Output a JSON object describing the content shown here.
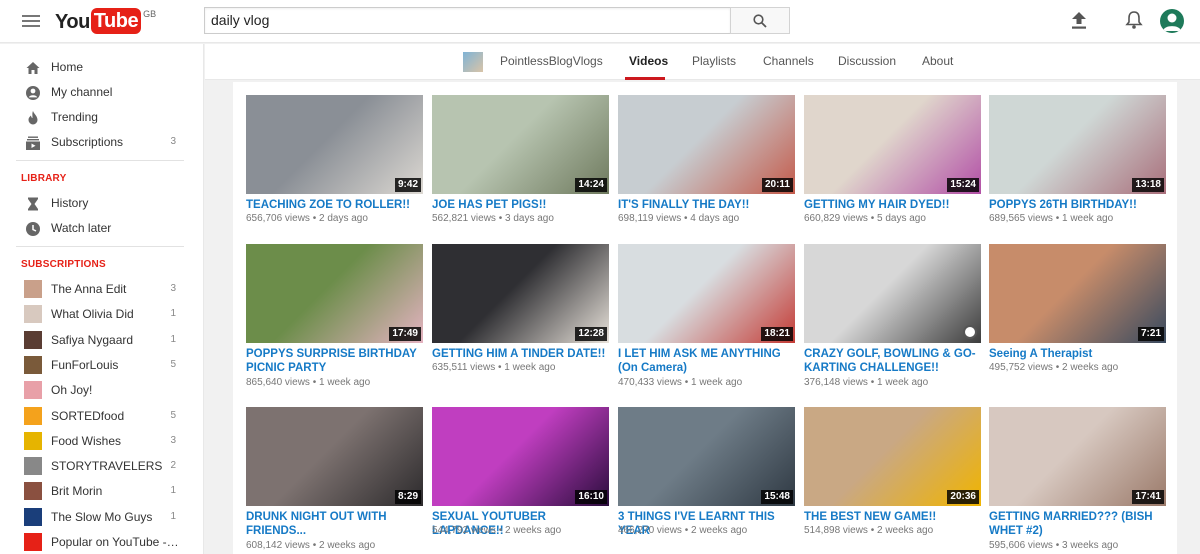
{
  "header": {
    "logo_you": "You",
    "logo_tube": "Tube",
    "logo_region": "GB",
    "search_value": "daily vlog"
  },
  "sidebar": {
    "nav": [
      {
        "label": "Home",
        "icon": "home-icon"
      },
      {
        "label": "My channel",
        "icon": "person-icon"
      },
      {
        "label": "Trending",
        "icon": "flame-icon"
      },
      {
        "label": "Subscriptions",
        "icon": "subscriptions-icon",
        "count": "3"
      }
    ],
    "library_heading": "LIBRARY",
    "library": [
      {
        "label": "History",
        "icon": "hourglass-icon"
      },
      {
        "label": "Watch later",
        "icon": "clock-icon"
      }
    ],
    "subscriptions_heading": "SUBSCRIPTIONS",
    "subscriptions": [
      {
        "label": "The Anna Edit",
        "count": "3",
        "color": "#c9a08a"
      },
      {
        "label": "What Olivia Did",
        "count": "1",
        "color": "#d8c9bf"
      },
      {
        "label": "Safiya Nygaard",
        "count": "1",
        "color": "#5a3d33"
      },
      {
        "label": "FunForLouis",
        "count": "5",
        "color": "#7a5a3a"
      },
      {
        "label": "Oh Joy!",
        "count": "",
        "color": "#e8a0a8"
      },
      {
        "label": "SORTEDfood",
        "count": "5",
        "color": "#f4a21c"
      },
      {
        "label": "Food Wishes",
        "count": "3",
        "color": "#e6b400"
      },
      {
        "label": "STORYTRAVELERS",
        "count": "2",
        "color": "#888888"
      },
      {
        "label": "Brit Morin",
        "count": "1",
        "color": "#8a5040"
      },
      {
        "label": "The Slow Mo Guys",
        "count": "1",
        "color": "#1a3e7a"
      },
      {
        "label": "Popular on YouTube - U...",
        "count": "",
        "color": "#e62117"
      }
    ]
  },
  "channel": {
    "name": "PointlessBlogVlogs",
    "tabs": [
      "Videos",
      "Playlists",
      "Channels",
      "Discussion",
      "About"
    ],
    "active_tab": "Videos"
  },
  "videos": [
    {
      "title": "TEACHING ZOE TO ROLLER!!",
      "views": "656,706 views",
      "age": "2 days ago",
      "duration": "9:42",
      "colors": [
        "#8a8f96",
        "#dcd8d2"
      ]
    },
    {
      "title": "JOE HAS PET PIGS!!",
      "views": "562,821 views",
      "age": "3 days ago",
      "duration": "14:24",
      "colors": [
        "#b7c4b0",
        "#6f7a5e"
      ]
    },
    {
      "title": "IT'S FINALLY THE DAY!!",
      "views": "698,119 views",
      "age": "4 days ago",
      "duration": "20:11",
      "colors": [
        "#c7cdd1",
        "#c45a4a"
      ]
    },
    {
      "title": "GETTING MY HAIR DYED!!",
      "views": "660,829 views",
      "age": "5 days ago",
      "duration": "15:24",
      "colors": [
        "#e0d6cc",
        "#b24fa6"
      ]
    },
    {
      "title": "POPPYS 26TH BIRTHDAY!!",
      "views": "689,565 views",
      "age": "1 week ago",
      "duration": "13:18",
      "colors": [
        "#cfd7d5",
        "#a96f7b"
      ]
    },
    {
      "title": "POPPYS SURPRISE BIRTHDAY PICNIC PARTY",
      "views": "865,640 views",
      "age": "1 week ago",
      "duration": "17:49",
      "colors": [
        "#6c8d4a",
        "#e4b3c1"
      ]
    },
    {
      "title": "GETTING HIM A TINDER DATE!!",
      "views": "635,511 views",
      "age": "1 week ago",
      "duration": "12:28",
      "colors": [
        "#2f2f33",
        "#e8e2da"
      ]
    },
    {
      "title": "I LET HIM ASK ME ANYTHING (On Camera)",
      "views": "470,433 views",
      "age": "1 week ago",
      "duration": "18:21",
      "colors": [
        "#d8dde0",
        "#c43b35"
      ]
    },
    {
      "title": "CRAZY GOLF, BOWLING & GO-KARTING CHALLENGE!!",
      "views": "376,148 views",
      "age": "1 week ago",
      "duration": "",
      "colors": [
        "#d7d7d7",
        "#3c3c3c"
      ]
    },
    {
      "title": "Seeing A Therapist",
      "views": "495,752 views",
      "age": "2 weeks ago",
      "duration": "7:21",
      "colors": [
        "#c78c6a",
        "#394a5f"
      ]
    },
    {
      "title": "DRUNK NIGHT OUT WITH FRIENDS...",
      "views": "608,142 views",
      "age": "2 weeks ago",
      "duration": "8:29",
      "colors": [
        "#7d7270",
        "#2c2a2c"
      ]
    },
    {
      "title": "SEXUAL YOUTUBER LAPDANCE!!",
      "views": "544,792 views",
      "age": "2 weeks ago",
      "duration": "16:10",
      "colors": [
        "#c03ec0",
        "#2a0d3d"
      ]
    },
    {
      "title": "3 THINGS I'VE LEARNT THIS YEAR",
      "views": "466,270 views",
      "age": "2 weeks ago",
      "duration": "15:48",
      "colors": [
        "#6e7c87",
        "#2f3943"
      ]
    },
    {
      "title": "THE BEST NEW GAME!!",
      "views": "514,898 views",
      "age": "2 weeks ago",
      "duration": "20:36",
      "colors": [
        "#c9a884",
        "#f0b400"
      ]
    },
    {
      "title": "GETTING MARRIED??? (BISH WHET #2)",
      "views": "595,606 views",
      "age": "3 weeks ago",
      "duration": "17:41",
      "colors": [
        "#d7c8c0",
        "#9b7a6a"
      ]
    }
  ]
}
